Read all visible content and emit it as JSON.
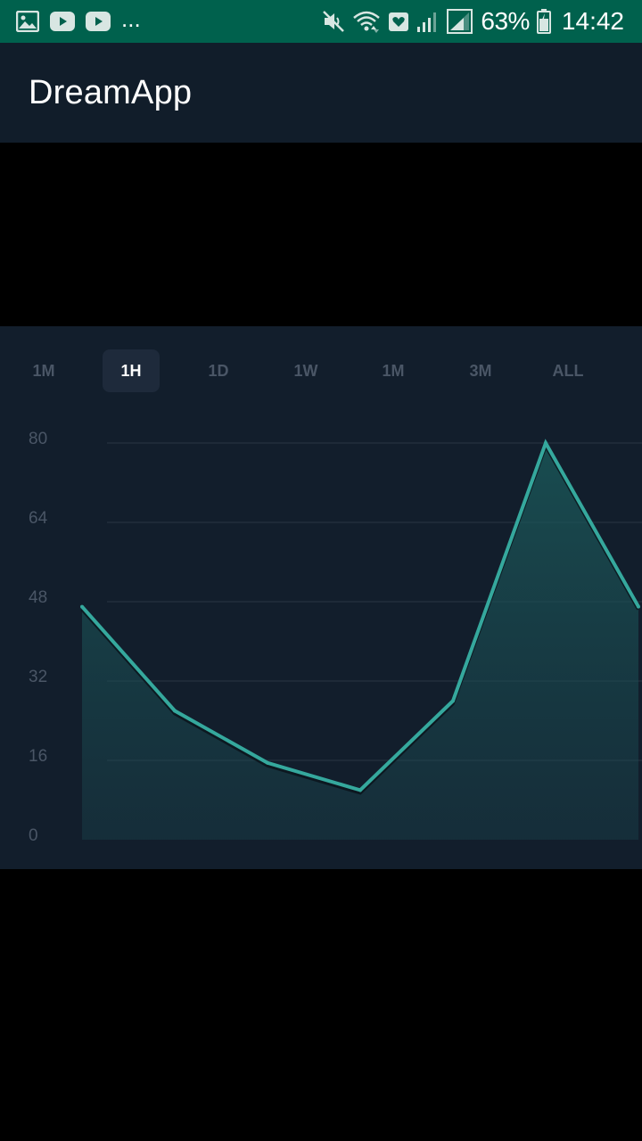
{
  "status_bar": {
    "left_icons": [
      "image-icon",
      "youtube-icon",
      "youtube-icon"
    ],
    "overflow": "...",
    "right_icons": [
      "mute-icon",
      "wifi-icon",
      "health-icon",
      "signal-weak-icon",
      "signal-icon",
      "battery-icon"
    ],
    "battery": "63%",
    "time": "14:42",
    "bg_color": "#00614d"
  },
  "app_bar": {
    "title": "DreamApp",
    "bg_color": "#111d2a"
  },
  "range_tabs": {
    "items": [
      {
        "label": "1M",
        "selected": false
      },
      {
        "label": "1H",
        "selected": true
      },
      {
        "label": "1D",
        "selected": false
      },
      {
        "label": "1W",
        "selected": false
      },
      {
        "label": "1M",
        "selected": false
      },
      {
        "label": "3M",
        "selected": false
      },
      {
        "label": "ALL",
        "selected": false
      }
    ]
  },
  "chart_data": {
    "type": "area",
    "x": [
      1,
      2,
      3,
      4,
      5,
      6,
      7
    ],
    "series": [
      {
        "values": [
          47,
          26,
          15.5,
          10,
          28,
          80,
          47
        ],
        "color": "#35a89d"
      }
    ],
    "yticks": [
      0,
      16,
      32,
      48,
      64,
      80
    ],
    "ylim": [
      0,
      80
    ],
    "grid": true,
    "legend": "none",
    "title": "",
    "xlabel": "",
    "ylabel": ""
  }
}
